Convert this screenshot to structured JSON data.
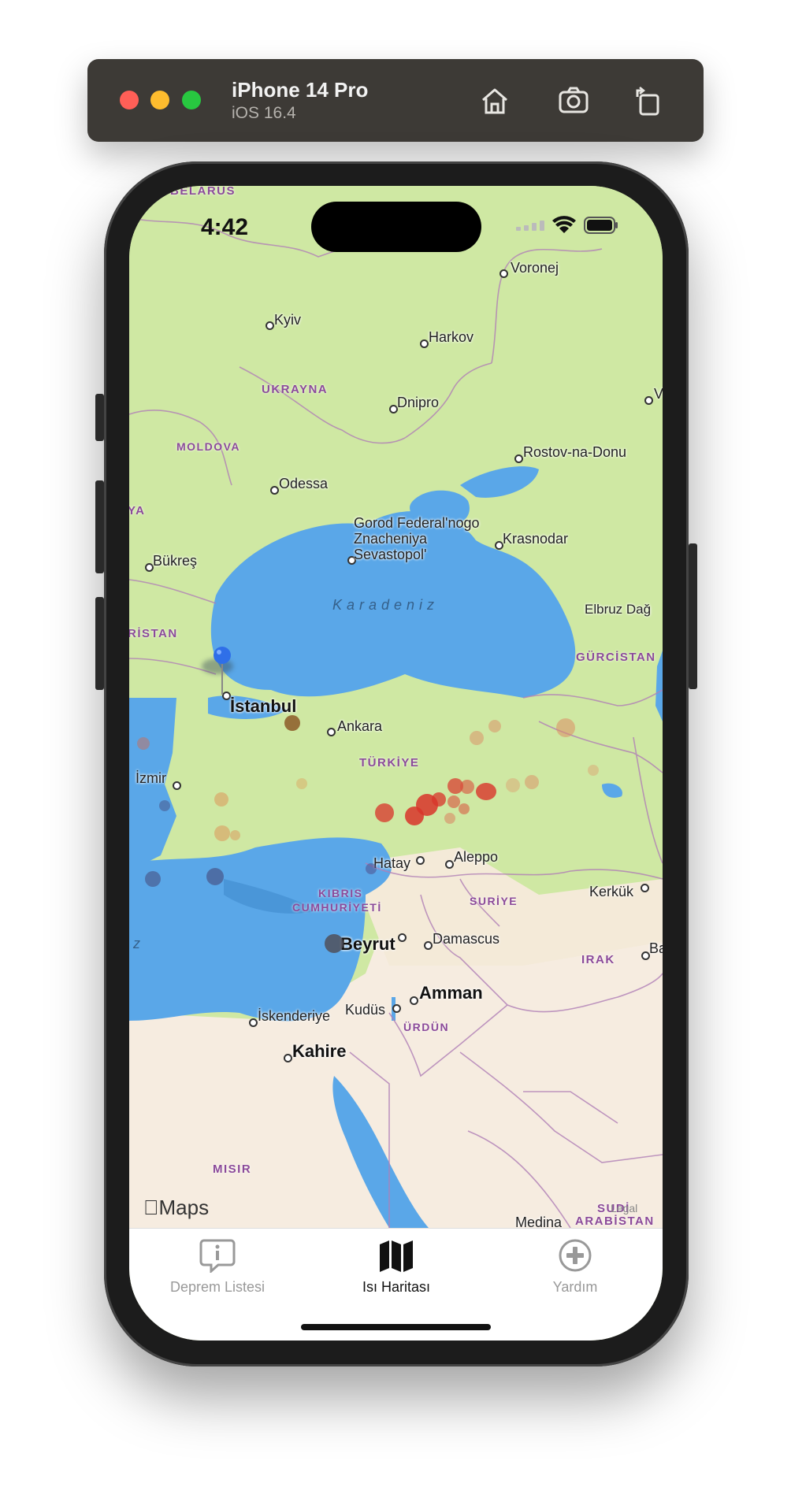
{
  "simulator": {
    "device_name": "iPhone 14 Pro",
    "os_version": "iOS 16.4",
    "buttons": [
      "home-icon",
      "screenshot-icon",
      "rotate-icon"
    ]
  },
  "status_bar": {
    "time": "4:42",
    "icons": [
      "cellular-icon",
      "wifi-icon",
      "battery-icon"
    ]
  },
  "map": {
    "attribution": "Maps",
    "sea_label": "Karadeniz",
    "country_labels": {
      "belarus": "BELARUS",
      "ukrayna": "UKRAYNA",
      "moldova": "MOLDOVA",
      "romanya_partial": "YA",
      "bulgaristan_partial": "RİSTAN",
      "gurcistan": "GÜRCİSTAN",
      "turkiye": "TÜRKİYE",
      "kibris_1": "KIBRIS",
      "kibris_2": "CUMHURİYETİ",
      "suriye": "SURİYE",
      "irak": "IRAK",
      "urdun": "ÜRDÜN",
      "misir": "MISIR",
      "sudi_1": "SUDİ",
      "sudi_2": "ARABİSTAN"
    },
    "city_labels": {
      "voronej": "Voronej",
      "kyiv": "Kyiv",
      "harkov": "Harkov",
      "dnipro": "Dnipro",
      "rostov": "Rostov-na-Donu",
      "odessa": "Odessa",
      "sevastopol_1": "Gorod Federal'nogo",
      "sevastopol_2": "Znacheniya",
      "sevastopol_3": "Sevastopol'",
      "krasnodar": "Krasnodar",
      "bukres": "Bükreş",
      "elbruz": "Elbruz Dağ",
      "istanbul": "İstanbul",
      "ankara": "Ankara",
      "izmir": "İzmir",
      "hatay": "Hatay",
      "aleppo": "Aleppo",
      "kerkuk": "Kerkük",
      "beyrut": "Beyrut",
      "damascus": "Damascus",
      "ba_partial": "Ba",
      "v_partial": "V",
      "kudus": "Kudüs",
      "amman": "Amman",
      "iskenderiye": "İskenderiye",
      "kahire": "Kahire",
      "medina": "Medina",
      "z_partial": "z"
    }
  },
  "tabs": [
    {
      "label": "Deprem Listesi",
      "icon": "info-bubble-icon",
      "selected": false
    },
    {
      "label": "Isı Haritası",
      "icon": "map-icon",
      "selected": true
    },
    {
      "label": "Yardım",
      "icon": "plus-circle-icon",
      "selected": false
    }
  ],
  "colors": {
    "land": "#cfe8a3",
    "sea": "#5aa7e8",
    "desert": "#f6ece0",
    "pin": "#2f6fe8",
    "quake_red": "#d8342a",
    "quake_orange": "#e09060",
    "tab_active": "#111111",
    "tab_inactive": "#999999"
  }
}
